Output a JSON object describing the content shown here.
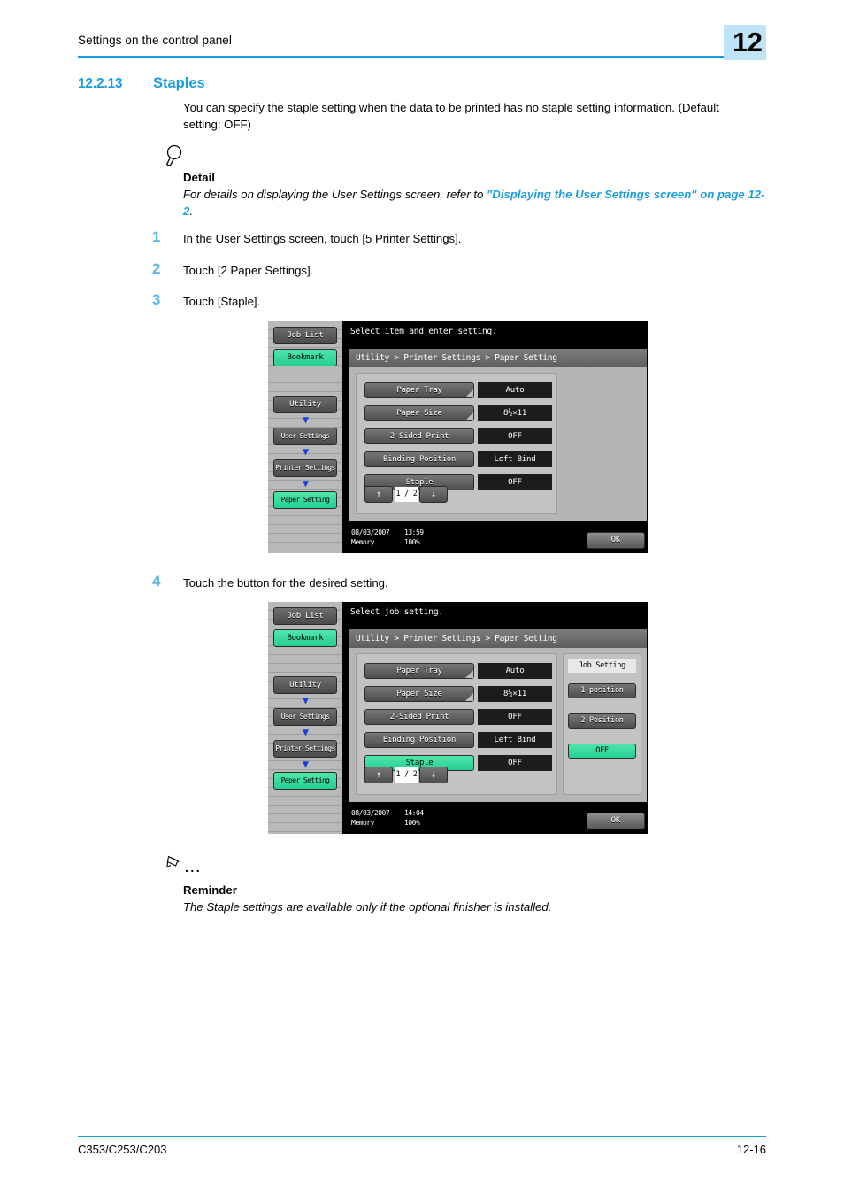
{
  "header": {
    "title": "Settings on the control panel",
    "chapter": "12"
  },
  "section": {
    "number": "12.2.13",
    "title": "Staples",
    "intro": "You can specify the staple setting when the data to be printed has no staple setting information. (Default setting: OFF)"
  },
  "detail": {
    "icon": "magnifier-icon",
    "label": "Detail",
    "text_before": "For details on displaying the User Settings screen, refer to ",
    "link": "\"Displaying the User Settings screen\" on page 12-2",
    "text_after": "."
  },
  "steps": [
    {
      "number": "1",
      "text": "In the User Settings screen, touch [5 Printer Settings]."
    },
    {
      "number": "2",
      "text": "Touch [2 Paper Settings]."
    },
    {
      "number": "3",
      "text": "Touch [Staple]."
    },
    {
      "number": "4",
      "text": "Touch the button for the desired setting."
    }
  ],
  "reminder": {
    "icon": "pencil-icon",
    "dots": "...",
    "label": "Reminder",
    "text": "The Staple settings are available only if the optional finisher is installed."
  },
  "footer": {
    "left": "C353/C253/C203",
    "right": "12-16"
  },
  "colors": {
    "accent_blue": "#1a9de0",
    "step_blue": "#5bb8e8",
    "panel_green": "#25cf92",
    "chapter_badge": "#bfe4f7",
    "arrow_blue": "#1840d8"
  },
  "panel1": {
    "message": "Select item and enter setting.",
    "breadcrumb": "Utility > Printer Settings > Paper Setting",
    "sidebar": [
      {
        "label": "Job List",
        "state": "dark"
      },
      {
        "label": "Bookmark",
        "state": "green"
      },
      {
        "label": "Utility",
        "state": "dark"
      },
      {
        "label": "User Settings",
        "state": "dark"
      },
      {
        "label": "Printer Settings",
        "state": "dark"
      },
      {
        "label": "Paper Setting",
        "state": "green"
      }
    ],
    "settings": [
      {
        "name": "Paper Tray",
        "value": "Auto",
        "selected": false,
        "corner": true
      },
      {
        "name": "Paper Size",
        "value": "8½×11",
        "selected": false,
        "corner": true
      },
      {
        "name": "2-Sided Print",
        "value": "OFF",
        "selected": false,
        "corner": false
      },
      {
        "name": "Binding Position",
        "value": "Left Bind",
        "selected": false,
        "corner": false
      },
      {
        "name": "Staple",
        "value": "OFF",
        "selected": false,
        "corner": false
      }
    ],
    "pager": {
      "up": "↑",
      "page": "1 / 2",
      "down": "↓"
    },
    "status": {
      "date": "08/03/2007",
      "time": "13:59",
      "memory_label": "Memory",
      "memory_value": "100%"
    },
    "ok": "OK"
  },
  "panel2": {
    "message": "Select job setting.",
    "breadcrumb": "Utility > Printer Settings > Paper Setting",
    "sidebar": [
      {
        "label": "Job List",
        "state": "dark"
      },
      {
        "label": "Bookmark",
        "state": "green"
      },
      {
        "label": "Utility",
        "state": "dark"
      },
      {
        "label": "User Settings",
        "state": "dark"
      },
      {
        "label": "Printer Settings",
        "state": "dark"
      },
      {
        "label": "Paper Setting",
        "state": "green"
      }
    ],
    "settings": [
      {
        "name": "Paper Tray",
        "value": "Auto",
        "selected": false,
        "corner": true
      },
      {
        "name": "Paper Size",
        "value": "8½×11",
        "selected": false,
        "corner": true
      },
      {
        "name": "2-Sided Print",
        "value": "OFF",
        "selected": false,
        "corner": false
      },
      {
        "name": "Binding Position",
        "value": "Left Bind",
        "selected": false,
        "corner": false
      },
      {
        "name": "Staple",
        "value": "OFF",
        "selected": true,
        "corner": false
      }
    ],
    "job_panel": {
      "title": "Job Setting",
      "options": [
        {
          "label": "1 position",
          "state": "dark"
        },
        {
          "label": "2 Position",
          "state": "dark"
        },
        {
          "label": "OFF",
          "state": "green"
        }
      ]
    },
    "pager": {
      "up": "↑",
      "page": "1 / 2",
      "down": "↓"
    },
    "status": {
      "date": "08/03/2007",
      "time": "14:04",
      "memory_label": "Memory",
      "memory_value": "100%"
    },
    "ok": "OK"
  }
}
